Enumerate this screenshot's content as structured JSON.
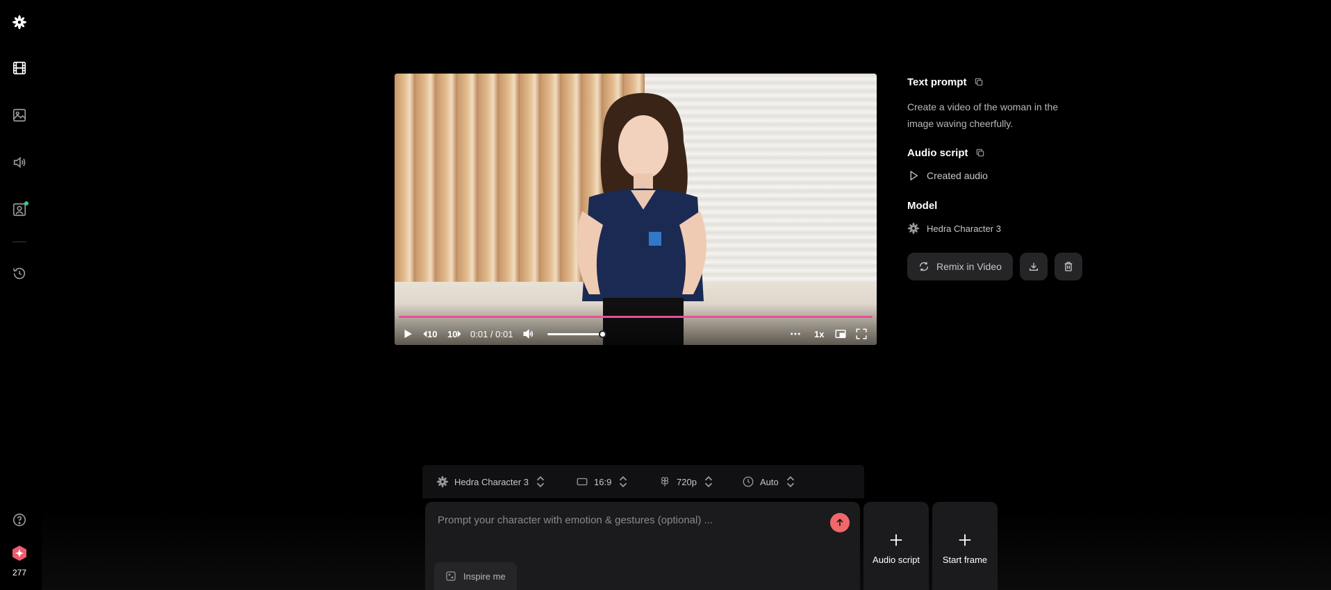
{
  "sidebar": {
    "credits": "277"
  },
  "video": {
    "rewind_label": "10",
    "forward_label": "10",
    "time": "0:01 / 0:01",
    "speed": "1x",
    "volume_percent": 100,
    "progress_percent": 100
  },
  "panel": {
    "text_prompt_heading": "Text prompt",
    "text_prompt": "Create a video of the woman in the image waving cheerfully.",
    "audio_script_heading": "Audio script",
    "audio_label": "Created audio",
    "model_heading": "Model",
    "model_name": "Hedra Character 3",
    "remix_label": "Remix in Video"
  },
  "composer": {
    "model": "Hedra Character 3",
    "aspect": "16:9",
    "resolution": "720p",
    "duration": "Auto",
    "placeholder": "Prompt your character with emotion & gestures (optional) ...",
    "inspire_label": "Inspire me",
    "audio_tile_label": "Audio script",
    "frame_tile_label": "Start frame"
  },
  "colors": {
    "accent_pink": "#e8509b",
    "send_button": "#f0686a",
    "status_dot": "#2ecc9b"
  }
}
